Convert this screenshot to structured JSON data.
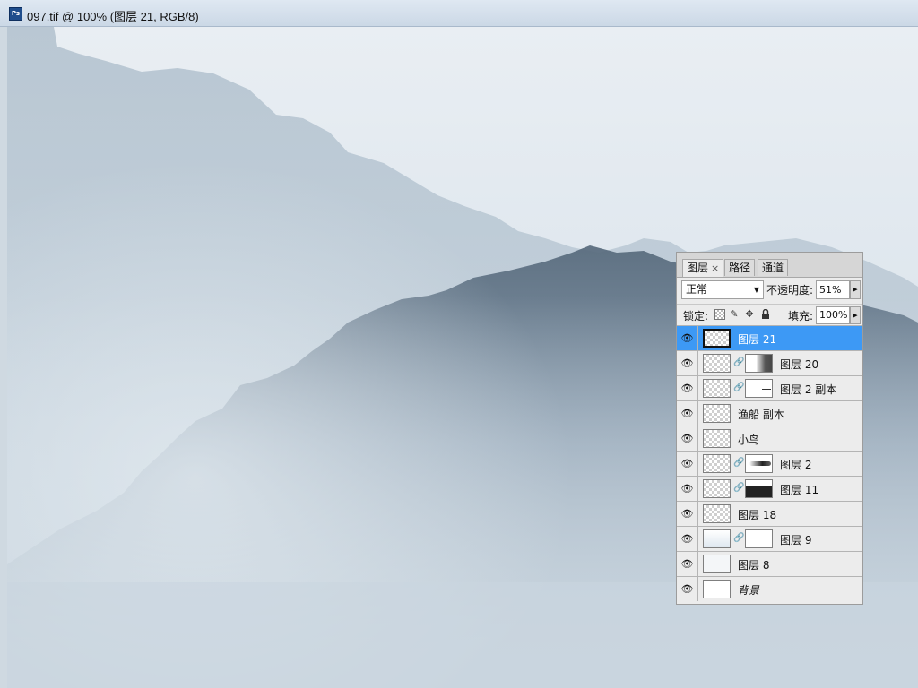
{
  "window": {
    "title": "097.tif @ 100% (图层 21, RGB/8)",
    "app_icon": "photoshop-icon"
  },
  "panel": {
    "tabs": [
      {
        "label": "图层",
        "active": true,
        "close": "×"
      },
      {
        "label": "路径",
        "active": false
      },
      {
        "label": "通道",
        "active": false
      }
    ],
    "blend_mode": "正常",
    "opacity_label": "不透明度:",
    "opacity_value": "51%",
    "lock_label": "锁定:",
    "lock_icons": [
      "lock-transparent-icon",
      "lock-brush-icon",
      "lock-move-icon",
      "lock-all-icon"
    ],
    "fill_label": "填充:",
    "fill_value": "100%",
    "layers": [
      {
        "name": "图层 21",
        "selected": true,
        "has_mask": false
      },
      {
        "name": "图层 20",
        "selected": false,
        "has_mask": true
      },
      {
        "name": "图层 2 副本",
        "selected": false,
        "has_mask": true
      },
      {
        "name": "渔船 副本",
        "selected": false,
        "has_mask": false
      },
      {
        "name": "小鸟",
        "selected": false,
        "has_mask": false
      },
      {
        "name": "图层 2",
        "selected": false,
        "has_mask": true
      },
      {
        "name": "图层 11",
        "selected": false,
        "has_mask": true
      },
      {
        "name": "图层 18",
        "selected": false,
        "has_mask": false
      },
      {
        "name": "图层 9",
        "selected": false,
        "has_mask": true
      },
      {
        "name": "图层 8",
        "selected": false,
        "has_mask": false
      },
      {
        "name": "背景",
        "selected": false,
        "has_mask": false,
        "italic": true
      }
    ]
  },
  "colors": {
    "selected_row": "#3d99f5",
    "mountain_dark": "#5b6f81",
    "mountain_light": "#a7b8c6"
  }
}
